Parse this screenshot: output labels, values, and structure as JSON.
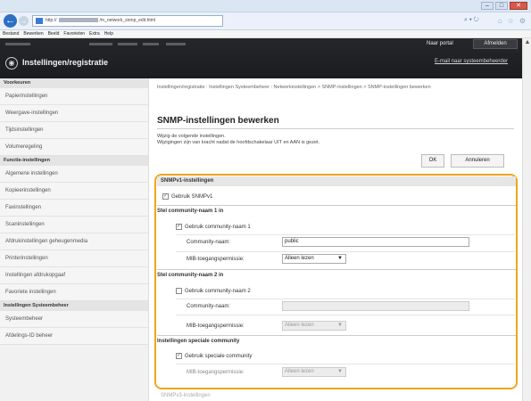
{
  "browser": {
    "address_prefix": "http://",
    "address_suffix": "/m_network_snmp_edit.html",
    "address_tools": "⌕ ▾ ↻",
    "menu": [
      "Bestand",
      "Bewerken",
      "Beeld",
      "Favorieten",
      "Extra",
      "Help"
    ]
  },
  "header": {
    "app_title": "Instellingen/registratie",
    "portal_link": "Naar portal",
    "logout": "Afmelden",
    "mail_link": "E-mail naar systeembeheerder"
  },
  "sidebar": {
    "sections": [
      {
        "title": "Voorkeuren",
        "items": [
          "Papierinstellingen",
          "Weergave-instellingen",
          "Tijdsinstellingen",
          "Volumeregeling"
        ]
      },
      {
        "title": "Functie-instellingen",
        "items": [
          "Algemene instellingen",
          "Kopieerinstellingen",
          "Faxinstellingen",
          "Scaninstellingen",
          "Afdrukinstellingen geheugenmedia",
          "Printerinstellingen",
          "Instellingen afdrukopgaaf",
          "Favoriete instellingen"
        ]
      },
      {
        "title": "Instellingen Systeembeheer",
        "items": [
          "Systeembeheer",
          "Afdelings-ID beheer"
        ]
      }
    ]
  },
  "main": {
    "breadcrumb": "Instellingen/registratie : Instellingen Systeembeheer : Netwerkinstellingen > SNMP-instellingen > SNMP-instellingen bewerken",
    "page_title": "SNMP-instellingen bewerken",
    "intro_line1": "Wijzig de volgende instellingen.",
    "intro_line2": "Wijzigingen zijn van kracht nadat de hoofdschakelaar UIT en AAN is gezet.",
    "ok": "OK",
    "cancel": "Annuleren",
    "snmpv1_title": "SNMPv1-instellingen",
    "use_snmpv1": "Gebruik SNMPv1",
    "set1_title": "Stel community-naam 1 in",
    "use_cn1": "Gebruik community-naam 1",
    "community_label": "Community-naam:",
    "community1_value": "public",
    "mib_label": "MIB-toegangspermissie:",
    "mib_value": "Alleen lezen",
    "set2_title": "Stel community-naam 2 in",
    "use_cn2": "Gebruik community-naam 2",
    "special_title": "Instellingen speciale community",
    "use_special": "Gebruik speciale community",
    "snmpv3_title": "SNMPv3-instellingen"
  }
}
